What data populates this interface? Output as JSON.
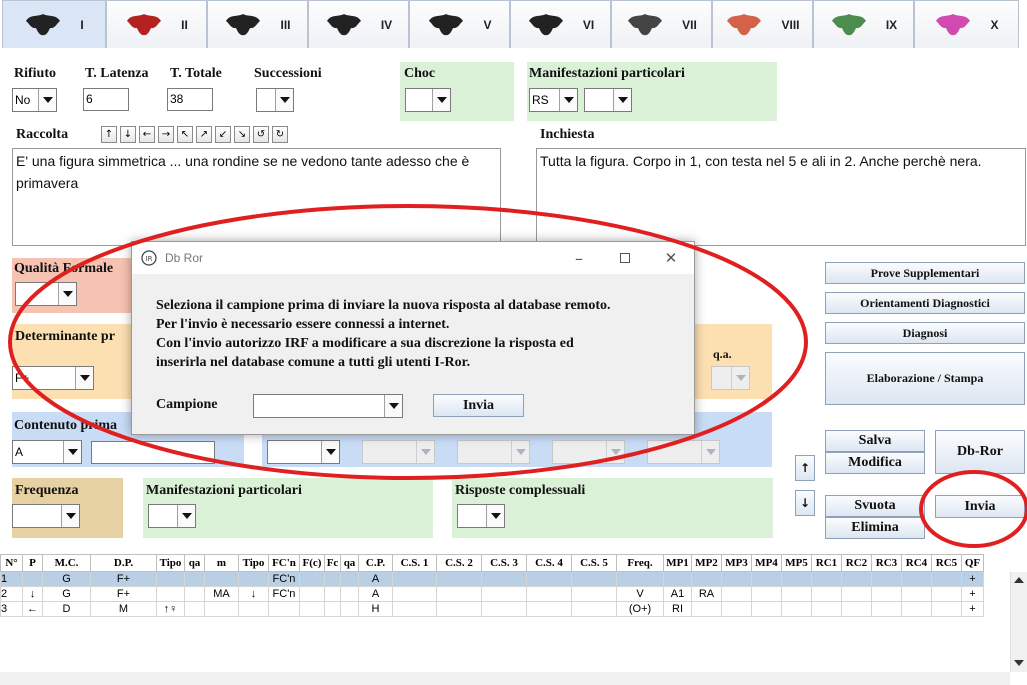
{
  "tabs": [
    {
      "label": "I",
      "color": "#222"
    },
    {
      "label": "II",
      "color": "#b52020"
    },
    {
      "label": "III",
      "color": "#222"
    },
    {
      "label": "IV",
      "color": "#222"
    },
    {
      "label": "V",
      "color": "#222"
    },
    {
      "label": "VI",
      "color": "#222"
    },
    {
      "label": "VII",
      "color": "#444"
    },
    {
      "label": "VIII",
      "color": "#d4624a"
    },
    {
      "label": "IX",
      "color": "#4c8c4c"
    },
    {
      "label": "X",
      "color": "#d04ab0"
    }
  ],
  "top": {
    "rifiuto_label": "Rifiuto",
    "rifiuto_value": "No",
    "latenza_label": "T. Latenza",
    "latenza_value": "6",
    "totale_label": "T. Totale",
    "totale_value": "38",
    "successioni_label": "Successioni",
    "successioni_value": "",
    "choc_label": "Choc",
    "choc_value": "",
    "manif_label": "Manifestazioni particolari",
    "manif_value1": "RS",
    "manif_value2": ""
  },
  "raccolta": {
    "label": "Raccolta",
    "arrows": [
      "↑",
      "↓",
      "←",
      "→",
      "↖",
      "↗",
      "↙",
      "↘",
      "↺",
      "↻"
    ],
    "text": "E' una figura simmetrica ... una rondine se ne vedono tante adesso che è primavera"
  },
  "inchiesta": {
    "label": "Inchiesta",
    "text": "Tutta la figura. Corpo in 1, con testa nel 5 e ali in 2. Anche perchè nera."
  },
  "qualita": {
    "label": "Qualità Formale",
    "value": ""
  },
  "determinante": {
    "label": "Determinante pr",
    "value": "F+",
    "qa_label": "q.a."
  },
  "contenuto": {
    "label": "Contenuto prima",
    "value": "A"
  },
  "frequenza": {
    "label": "Frequenza"
  },
  "manif2": {
    "label": "Manifestazioni particolari"
  },
  "risposte": {
    "label": "Risposte complessuali"
  },
  "side_buttons": {
    "prove": "Prove Supplementari",
    "orientamenti": "Orientamenti Diagnostici",
    "diagnosi": "Diagnosi",
    "elaborazione": "Elaborazione / Stampa",
    "salva": "Salva",
    "modifica": "Modifica",
    "dbror": "Db-Ror",
    "svuota": "Svuota",
    "elimina": "Elimina",
    "invia": "Invia",
    "up": "↑",
    "down": "↓"
  },
  "dialog": {
    "title": "Db Ror",
    "line1": "Seleziona il campione prima di inviare la nuova risposta al database remoto.",
    "line2": "Per l'invio è necessario essere connessi a internet.",
    "line3": "Con l'invio autorizzo IRF a modificare a sua discrezione la risposta ed",
    "line4": "inserirla nel database comune a tutti gli utenti I-Ror.",
    "campione_label": "Campione",
    "campione_value": "",
    "send": "Invia"
  },
  "table": {
    "columns": [
      "N°",
      "P",
      "M.C.",
      "D.P.",
      "Tipo",
      "qa",
      "m",
      "Tipo",
      "FC'n",
      "F(c)",
      "Fc",
      "qa",
      "C.P.",
      "C.S. 1",
      "C.S. 2",
      "C.S. 3",
      "C.S. 4",
      "C.S. 5",
      "Freq.",
      "MP1",
      "MP2",
      "MP3",
      "MP4",
      "MP5",
      "RC1",
      "RC2",
      "RC3",
      "RC4",
      "RC5",
      "QF"
    ],
    "rows": [
      [
        "1",
        "",
        "G",
        "F+",
        "",
        "",
        "",
        "",
        "FC'n",
        "",
        "",
        "",
        "A",
        "",
        "",
        "",
        "",
        "",
        "",
        "",
        "",
        "",
        "",
        "",
        "",
        "",
        "",
        "",
        "",
        "+"
      ],
      [
        "2",
        "↓",
        "G",
        "F+",
        "",
        "",
        "MA",
        "↓",
        "FC'n",
        "",
        "",
        "",
        "A",
        "",
        "",
        "",
        "",
        "",
        "V",
        "A1",
        "RA",
        "",
        "",
        "",
        "",
        "",
        "",
        "",
        "",
        "+"
      ],
      [
        "3",
        "←",
        "D",
        "M",
        "↑♀",
        "",
        "",
        "",
        "",
        "",
        "",
        "",
        "H",
        "",
        "",
        "",
        "",
        "",
        "(O+)",
        "RI",
        "",
        "",
        "",
        "",
        "",
        "",
        "",
        "",
        "",
        "+"
      ]
    ]
  }
}
